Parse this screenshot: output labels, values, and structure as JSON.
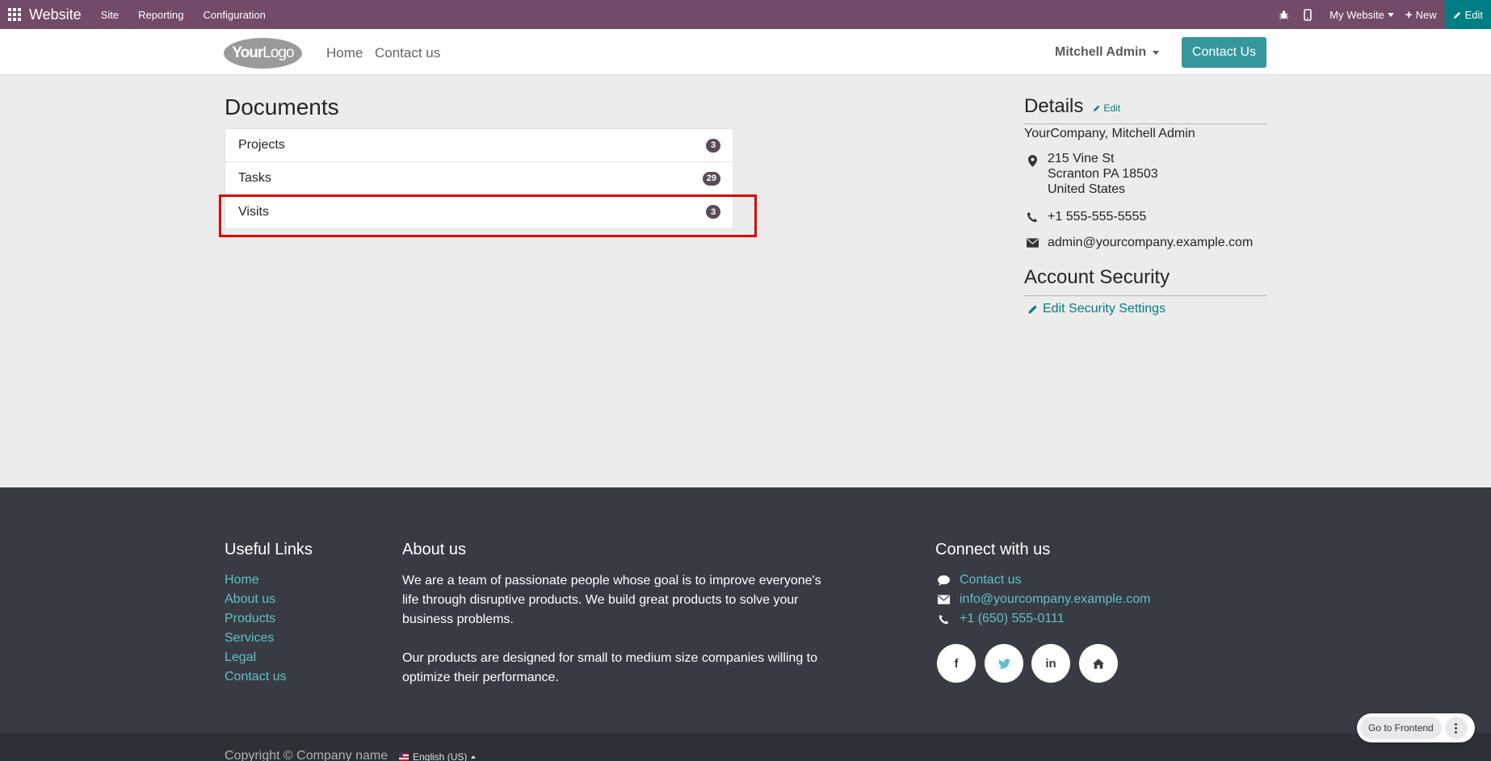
{
  "topbar": {
    "brand": "Website",
    "menus": [
      "Site",
      "Reporting",
      "Configuration"
    ],
    "my_website": "My Website",
    "new_label": "New",
    "edit_label": "Edit"
  },
  "header": {
    "logo_text_bold": "Your",
    "logo_text_thin": "Logo",
    "nav": [
      "Home",
      "Contact us"
    ],
    "user": "Mitchell Admin",
    "contact_button": "Contact Us"
  },
  "documents": {
    "title": "Documents",
    "items": [
      {
        "label": "Projects",
        "count": "3"
      },
      {
        "label": "Tasks",
        "count": "29"
      },
      {
        "label": "Visits",
        "count": "3"
      }
    ]
  },
  "details": {
    "title": "Details",
    "edit_label": "Edit",
    "company": "YourCompany, Mitchell Admin",
    "address": [
      "215 Vine St",
      "Scranton PA 18503",
      "United States"
    ],
    "phone": "+1 555-555-5555",
    "email": "admin@yourcompany.example.com"
  },
  "security": {
    "title": "Account Security",
    "link": "Edit Security Settings"
  },
  "footer": {
    "useful_title": "Useful Links",
    "useful_links": [
      "Home",
      "About us",
      "Products",
      "Services",
      "Legal",
      "Contact us"
    ],
    "about_title": "About us",
    "about_p1": "We are a team of passionate people whose goal is to improve everyone's life through disruptive products. We build great products to solve your business problems.",
    "about_p2": "Our products are designed for small to medium size companies willing to optimize their performance.",
    "connect_title": "Connect with us",
    "connect_contact": "Contact us",
    "connect_email": "info@yourcompany.example.com",
    "connect_phone": "+1 (650) 555-0111",
    "social": [
      "f",
      "t",
      "in",
      "home"
    ],
    "copyright": "Copyright © Company name",
    "language": "English (US)"
  },
  "floating": {
    "go_frontend": "Go to Frontend"
  },
  "colors": {
    "topbar": "#714b67",
    "accent": "#35979c",
    "footer": "#383b44",
    "highlight": "#e00000"
  }
}
